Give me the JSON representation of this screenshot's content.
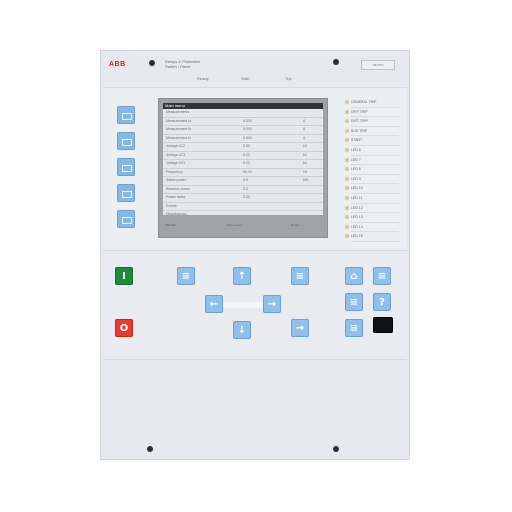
{
  "header": {
    "logo_text": "ABB",
    "maker_line1": "Relays & Protection",
    "maker_line2": "Switch / Panel",
    "model_text": "REL650",
    "led_labels": [
      "Ready",
      "Start",
      "Trip"
    ]
  },
  "lcd": {
    "title": "Main menu",
    "rows": [
      {
        "name": "Measurements",
        "value": "",
        "unit": ""
      },
      {
        "name": "Measurement Ia",
        "value": "0.000",
        "unit": "A"
      },
      {
        "name": "Measurement Ib",
        "value": "0.000",
        "unit": "A"
      },
      {
        "name": "Measurement Ic",
        "value": "0.000",
        "unit": "A"
      },
      {
        "name": "Voltage U12",
        "value": "0.00",
        "unit": "kV"
      },
      {
        "name": "Voltage U23",
        "value": "0.00",
        "unit": "kV"
      },
      {
        "name": "Voltage U31",
        "value": "0.00",
        "unit": "kV"
      },
      {
        "name": "Frequency",
        "value": "50.00",
        "unit": "Hz"
      },
      {
        "name": "Active power",
        "value": "0.0",
        "unit": "kW"
      },
      {
        "name": "Reactive power",
        "value": "0.0",
        "unit": ""
      },
      {
        "name": "Power factor",
        "value": "0.00",
        "unit": ""
      },
      {
        "name": "Events",
        "value": "",
        "unit": ""
      },
      {
        "name": "Disturbances",
        "value": "",
        "unit": ""
      },
      {
        "name": "Settings",
        "value": "",
        "unit": ""
      }
    ],
    "status": [
      "REL650",
      "Main menu",
      "Ready"
    ]
  },
  "led_panel": {
    "items": [
      "GENERAL TRIP",
      "DIFF TRIP",
      "DIST TRIP",
      "BUS TRIP",
      "START",
      "LED 6",
      "LED 7",
      "LED 8",
      "LED 9",
      "LED 10",
      "LED 11",
      "LED 12",
      "LED 13",
      "LED 14",
      "LED 15"
    ]
  },
  "keypad": {
    "open_symbol": "I",
    "close_symbol": "O",
    "up_symbol": "↑",
    "down_symbol": "↓",
    "left_symbol": "←",
    "right_symbol": "→",
    "menu_symbol": "≡",
    "help_symbol": "?",
    "home_symbol": "⌂"
  }
}
